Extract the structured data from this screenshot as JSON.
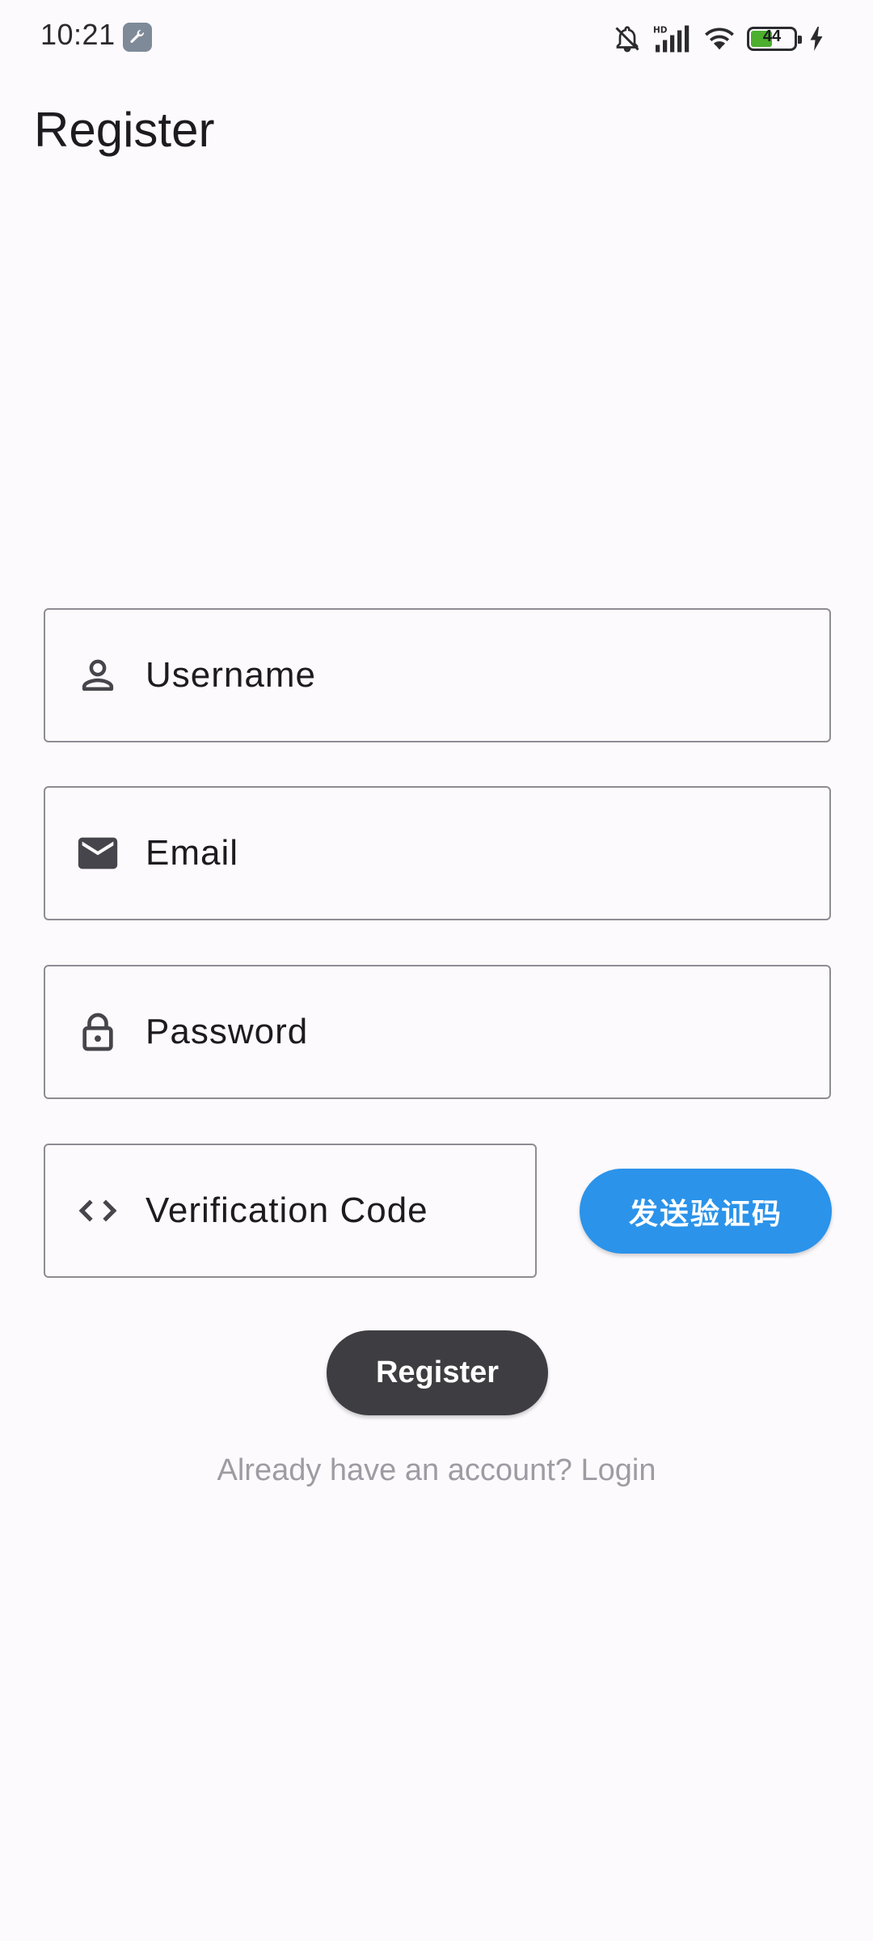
{
  "status_bar": {
    "time": "10:21",
    "battery_level": "44",
    "icons": [
      "wrench-app-icon",
      "bell-off-icon",
      "hd-signal-icon",
      "wifi-icon",
      "battery-icon",
      "charging-bolt-icon"
    ]
  },
  "header": {
    "title": "Register"
  },
  "form": {
    "username_placeholder": "Username",
    "email_placeholder": "Email",
    "password_placeholder": "Password",
    "code_placeholder": "Verification Code",
    "send_code_label": "发送验证码",
    "register_label": "Register",
    "login_prompt": "Already have an account? Login"
  },
  "colors": {
    "background": "#fcfafd",
    "send_button": "#2b93ea",
    "register_button": "#3e3d42",
    "field_border": "#8e8c93",
    "link_text": "#9e9ca3"
  }
}
